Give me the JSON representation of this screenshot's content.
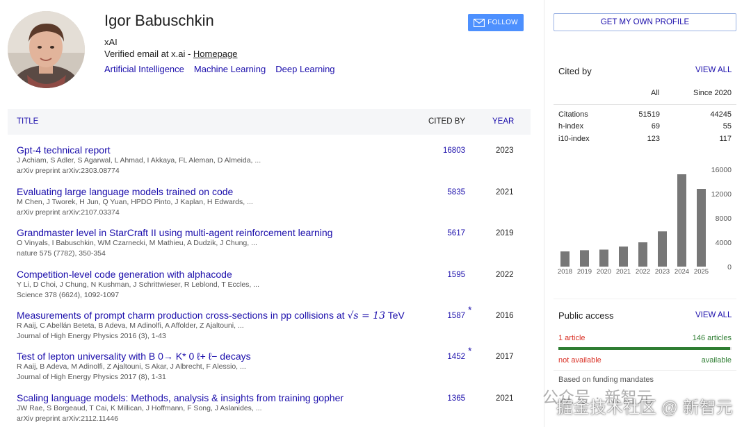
{
  "profile": {
    "name": "Igor Babuschkin",
    "affiliation": "xAI",
    "email_text": "Verified email at x.ai - ",
    "homepage": "Homepage",
    "interests": [
      "Artificial Intelligence",
      "Machine Learning",
      "Deep Learning"
    ]
  },
  "buttons": {
    "follow": "FOLLOW",
    "own_profile": "GET MY OWN PROFILE"
  },
  "table": {
    "headers": {
      "title": "TITLE",
      "cited_by": "CITED BY",
      "year": "YEAR"
    },
    "rows": [
      {
        "title": "Gpt-4 technical report",
        "authors": "J Achiam, S Adler, S Agarwal, L Ahmad, I Akkaya, FL Aleman, D Almeida, ...",
        "venue": "arXiv preprint arXiv:2303.08774",
        "cited": "16803",
        "year": "2023",
        "star": ""
      },
      {
        "title": "Evaluating large language models trained on code",
        "authors": "M Chen, J Tworek, H Jun, Q Yuan, HPDO Pinto, J Kaplan, H Edwards, ...",
        "venue": "arXiv preprint arXiv:2107.03374",
        "cited": "5835",
        "year": "2021",
        "star": ""
      },
      {
        "title": "Grandmaster level in StarCraft II using multi-agent reinforcement learning",
        "authors": "O Vinyals, I Babuschkin, WM Czarnecki, M Mathieu, A Dudzik, J Chung, ...",
        "venue": "nature 575 (7782), 350-354",
        "cited": "5617",
        "year": "2019",
        "star": ""
      },
      {
        "title": "Competition-level code generation with alphacode",
        "authors": "Y Li, D Choi, J Chung, N Kushman, J Schrittwieser, R Leblond, T Eccles, ...",
        "venue": "Science 378 (6624), 1092-1097",
        "cited": "1595",
        "year": "2022",
        "star": ""
      },
      {
        "title": "Measurements of prompt charm production cross-sections in pp collisions at",
        "math": "√s = 13",
        "title_suffix": " TeV",
        "authors": "R Aaij, C Abellán Beteta, B Adeva, M Adinolfi, A Affolder, Z Ajaltouni, ...",
        "venue": "Journal of High Energy Physics 2016 (3), 1-43",
        "cited": "1587",
        "year": "2016",
        "star": "*"
      },
      {
        "title": "Test of lepton universality with B 0→ K* 0 ℓ+ ℓ− decays",
        "authors": "R Aaij, B Adeva, M Adinolfi, Z Ajaltouni, S Akar, J Albrecht, F Alessio, ...",
        "venue": "Journal of High Energy Physics 2017 (8), 1-31",
        "cited": "1452",
        "year": "2017",
        "star": "*"
      },
      {
        "title": "Scaling language models: Methods, analysis & insights from training gopher",
        "authors": "JW Rae, S Borgeaud, T Cai, K Millican, J Hoffmann, F Song, J Aslanides, ...",
        "venue": "arXiv preprint arXiv:2112.11446",
        "cited": "1365",
        "year": "2021",
        "star": ""
      }
    ]
  },
  "cited_by": {
    "title": "Cited by",
    "view_all": "VIEW ALL",
    "col_all": "All",
    "col_since": "Since 2020",
    "rows": [
      {
        "label": "Citations",
        "all": "51519",
        "since": "44245"
      },
      {
        "label": "h-index",
        "all": "69",
        "since": "55"
      },
      {
        "label": "i10-index",
        "all": "123",
        "since": "117"
      }
    ]
  },
  "chart_data": {
    "type": "bar",
    "categories": [
      "2018",
      "2019",
      "2020",
      "2021",
      "2022",
      "2023",
      "2024",
      "2025"
    ],
    "values": [
      2500,
      2700,
      2800,
      3300,
      4000,
      5800,
      15200,
      12800
    ],
    "yticks": [
      "16000",
      "12000",
      "8000",
      "4000",
      "0"
    ],
    "ylim": [
      0,
      16000
    ],
    "bar_color": "#777777"
  },
  "public_access": {
    "title": "Public access",
    "view_all": "VIEW ALL",
    "left_count": "1 article",
    "right_count": "146 articles",
    "left_status": "not available",
    "right_status": "available",
    "available_fraction": 0.993,
    "footer": "Based on funding mandates"
  },
  "watermark": {
    "line1": "公众号 · 新智元",
    "line2": "掘金技术社区 @ 新智元"
  },
  "colors": {
    "link": "#1a0dab",
    "follow": "#4d90fe",
    "available": "#2e7d32",
    "unavailable": "#d93025"
  }
}
